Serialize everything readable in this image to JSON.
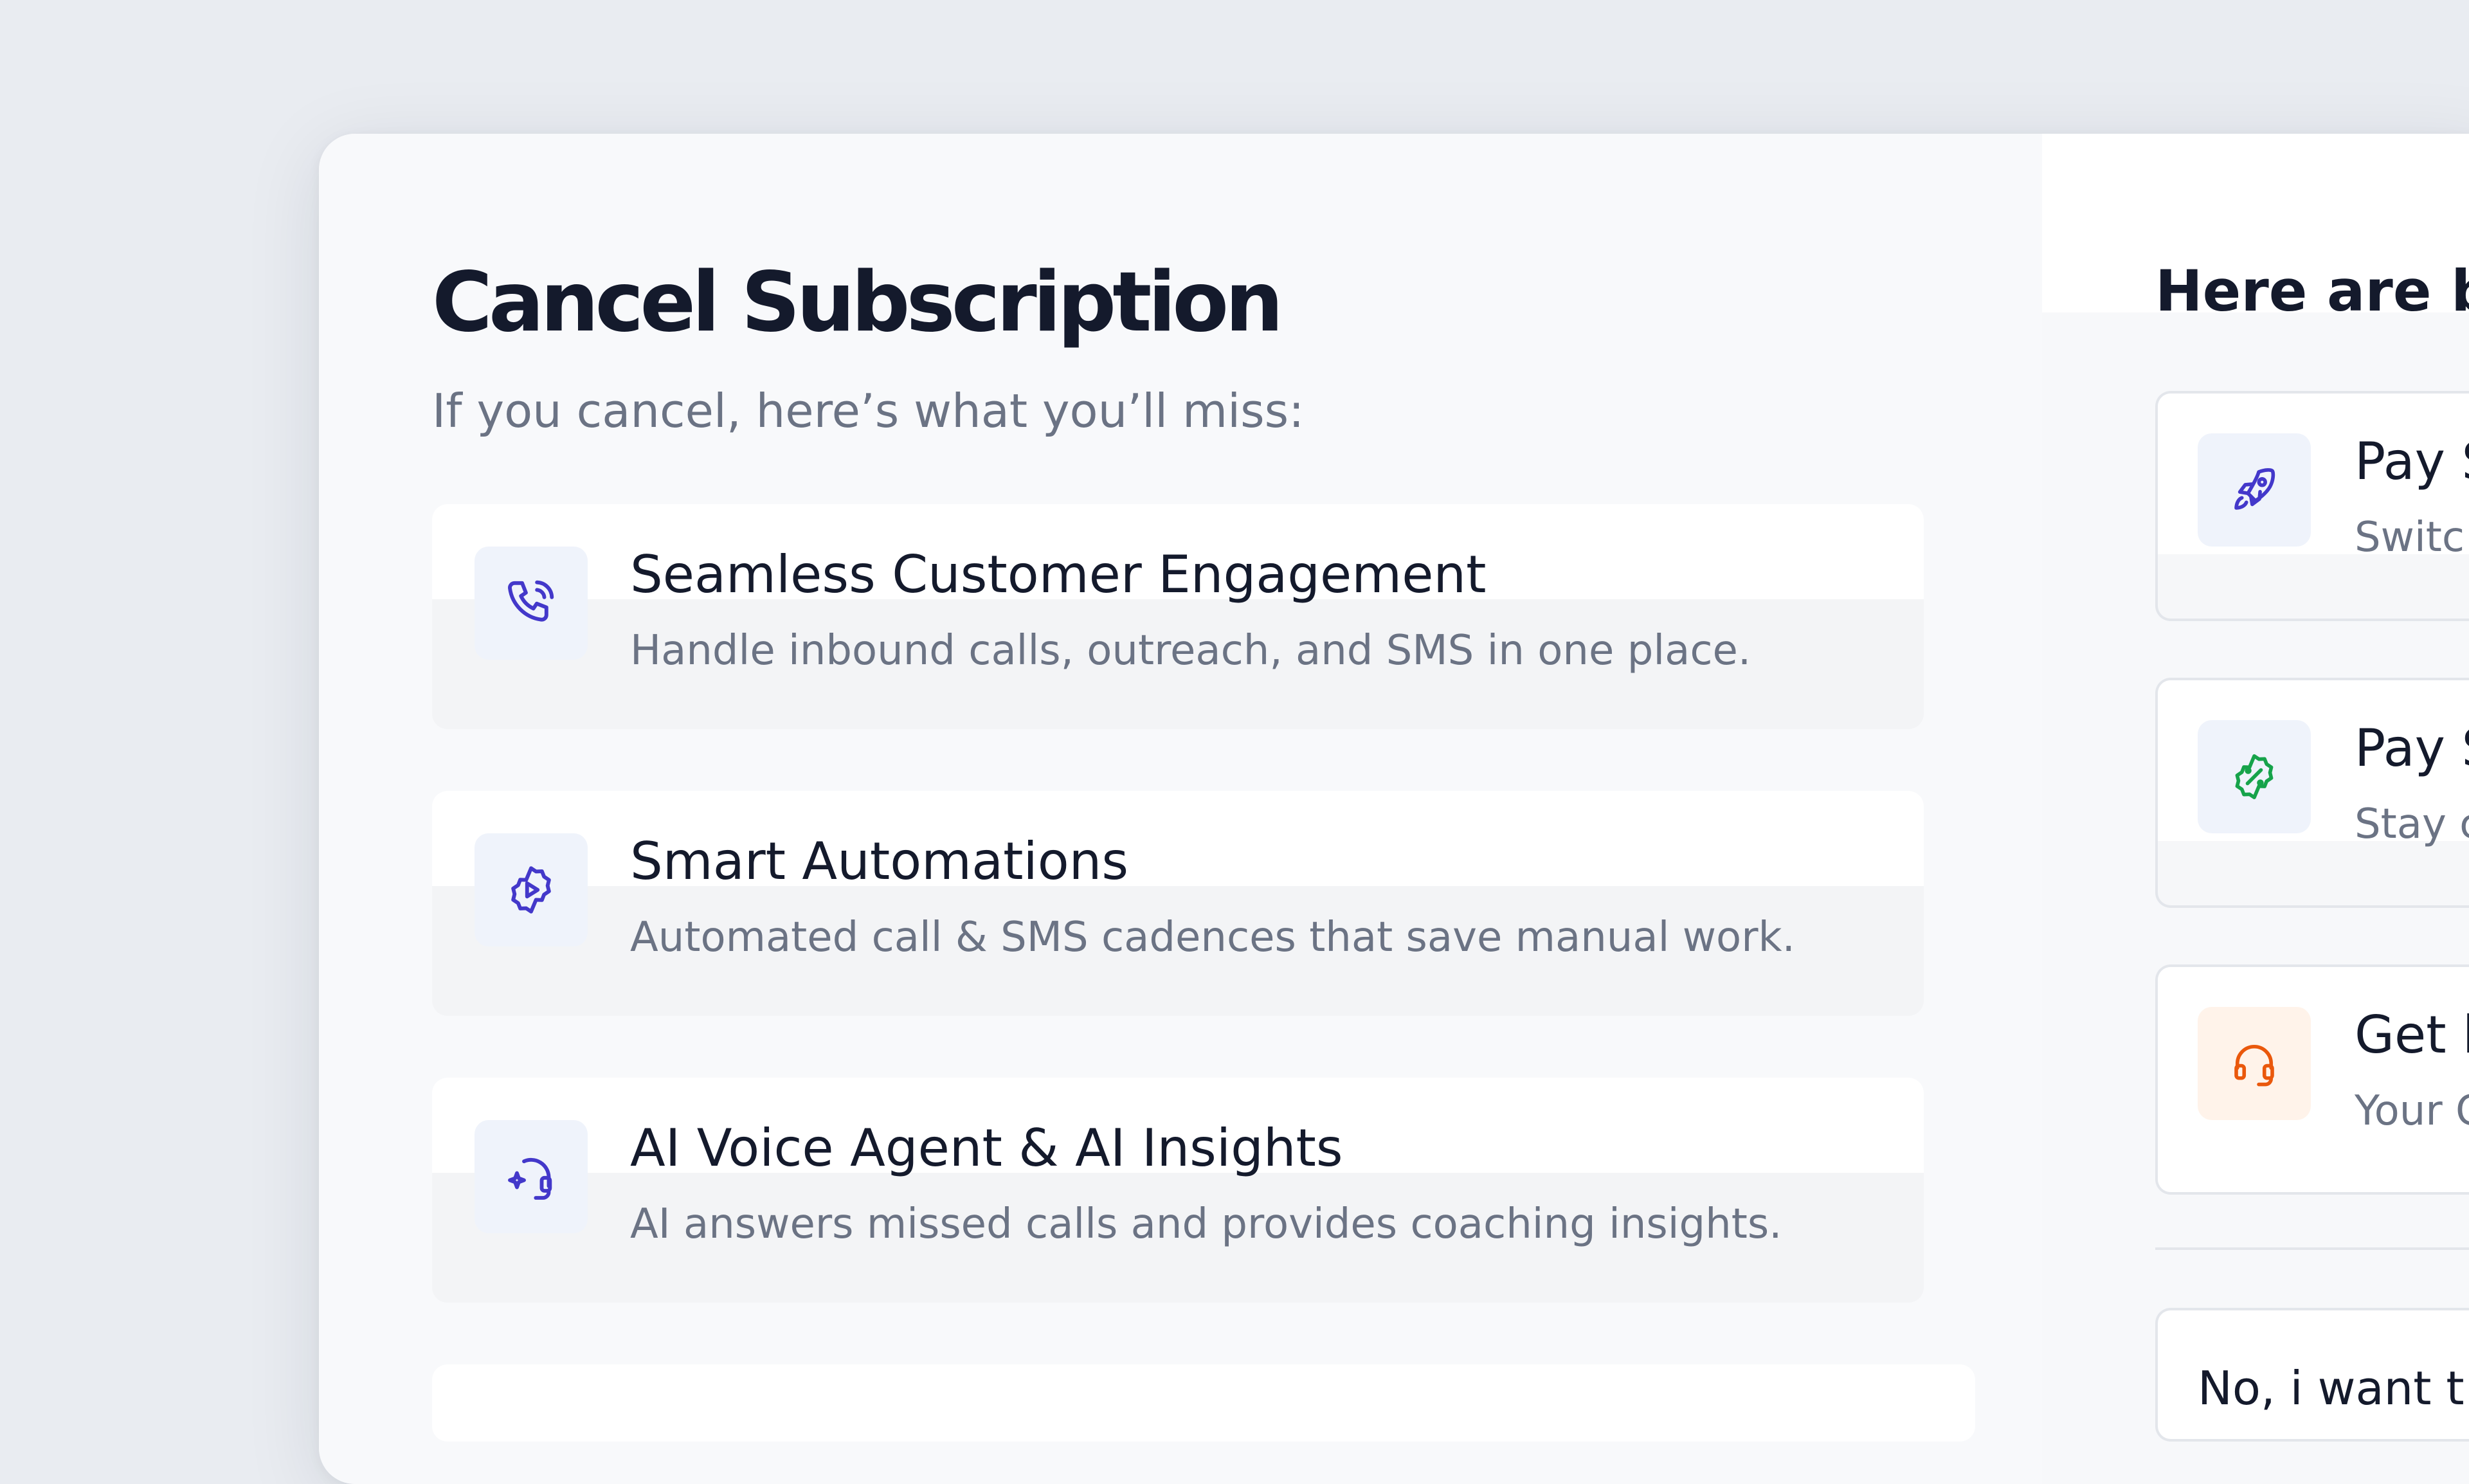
{
  "dialog": {
    "title": "Cancel Subscription",
    "subtitle": "If you cancel, here’s what you’ll miss:"
  },
  "features": [
    {
      "icon": "phone-call-icon",
      "title": "Seamless Customer Engagement",
      "description": "Handle inbound calls, outreach, and SMS in one place."
    },
    {
      "icon": "gear-play-icon",
      "title": "Smart Automations",
      "description": "Automated call & SMS cadences that save manual work."
    },
    {
      "icon": "headset-sparkle-icon",
      "title": "AI Voice Agent & AI Insights",
      "description": "AI answers missed calls and provides coaching insights."
    }
  ],
  "offers_panel": {
    "heading": "Here are be",
    "offers": [
      {
        "icon": "rocket-icon",
        "title": "Pay S",
        "description": "Switc",
        "accent": "#4338ca"
      },
      {
        "icon": "discount-badge-icon",
        "title": "Pay S",
        "description": "Stay c",
        "accent": "#16a34a"
      },
      {
        "icon": "headset-icon",
        "title": "Get h",
        "description": "Your C",
        "accent": "#ea580c"
      }
    ],
    "decline_label": "No, i want t"
  },
  "colors": {
    "background": "#e9ecf1",
    "panel": "#f8f9fb",
    "card": "#ffffff",
    "title_text": "#141a2c",
    "muted_text": "#6b7384",
    "feature_icon_accent": "#4338ca",
    "feature_icon_bg": "#eff3fb",
    "offer_icon_bg_blue": "#eff3fb",
    "offer_icon_bg_orange": "#fff3ea",
    "border": "#e3e6eb"
  }
}
